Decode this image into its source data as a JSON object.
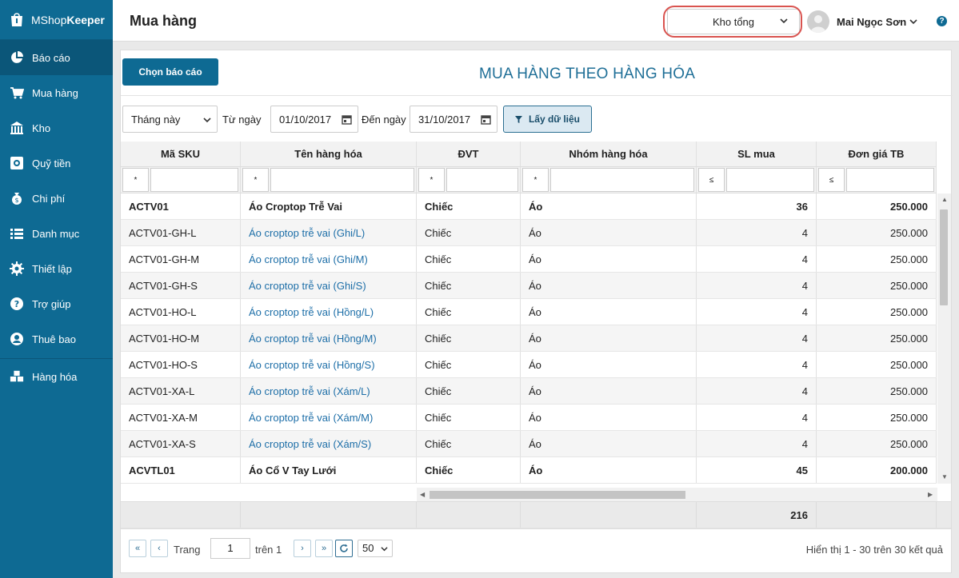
{
  "brand": {
    "name_light": "MShop",
    "name_bold": "Keeper"
  },
  "sidebar": {
    "items": [
      {
        "label": "Báo cáo",
        "icon": "pie-chart-icon"
      },
      {
        "label": "Mua hàng",
        "icon": "cart-icon"
      },
      {
        "label": "Kho",
        "icon": "warehouse-icon"
      },
      {
        "label": "Quỹ tiền",
        "icon": "safe-icon"
      },
      {
        "label": "Chi phí",
        "icon": "expense-icon"
      },
      {
        "label": "Danh mục",
        "icon": "list-icon"
      },
      {
        "label": "Thiết lập",
        "icon": "gear-icon"
      },
      {
        "label": "Trợ giúp",
        "icon": "help-icon"
      },
      {
        "label": "Thuê bao",
        "icon": "user-icon"
      },
      {
        "label": "Hàng hóa",
        "icon": "boxes-icon"
      }
    ]
  },
  "header": {
    "title": "Mua hàng",
    "store": "Kho tổng",
    "user": "Mai Ngọc Sơn",
    "help": "?"
  },
  "toolbar": {
    "choose_report": "Chọn báo cáo",
    "report_title": "MUA HÀNG THEO HÀNG HÓA",
    "period": "Tháng này",
    "from_label": "Từ ngày",
    "from_date": "01/10/2017",
    "to_label": "Đến ngày",
    "to_date": "31/10/2017",
    "fetch": "Lấy dữ liệu"
  },
  "table": {
    "columns": [
      "Mã SKU",
      "Tên hàng hóa",
      "ĐVT",
      "Nhóm hàng hóa",
      "SL mua",
      "Đơn giá TB"
    ],
    "filter_ops": [
      "*",
      "*",
      "*",
      "*",
      "≤",
      "≤"
    ],
    "rows": [
      {
        "sku": "ACTV01",
        "name": "Áo Croptop Trễ Vai",
        "unit": "Chiếc",
        "group": "Áo",
        "qty": "36",
        "price": "250.000"
      },
      {
        "sku": "ACTV01-GH-L",
        "name": "Áo croptop trễ vai (Ghi/L)",
        "unit": "Chiếc",
        "group": "Áo",
        "qty": "4",
        "price": "250.000"
      },
      {
        "sku": "ACTV01-GH-M",
        "name": "Áo croptop trễ vai (Ghi/M)",
        "unit": "Chiếc",
        "group": "Áo",
        "qty": "4",
        "price": "250.000"
      },
      {
        "sku": "ACTV01-GH-S",
        "name": "Áo croptop trễ vai (Ghi/S)",
        "unit": "Chiếc",
        "group": "Áo",
        "qty": "4",
        "price": "250.000"
      },
      {
        "sku": "ACTV01-HO-L",
        "name": "Áo croptop trễ vai (Hồng/L)",
        "unit": "Chiếc",
        "group": "Áo",
        "qty": "4",
        "price": "250.000"
      },
      {
        "sku": "ACTV01-HO-M",
        "name": "Áo croptop trễ vai (Hồng/M)",
        "unit": "Chiếc",
        "group": "Áo",
        "qty": "4",
        "price": "250.000"
      },
      {
        "sku": "ACTV01-HO-S",
        "name": "Áo croptop trễ vai (Hồng/S)",
        "unit": "Chiếc",
        "group": "Áo",
        "qty": "4",
        "price": "250.000"
      },
      {
        "sku": "ACTV01-XA-L",
        "name": "Áo croptop trễ vai (Xám/L)",
        "unit": "Chiếc",
        "group": "Áo",
        "qty": "4",
        "price": "250.000"
      },
      {
        "sku": "ACTV01-XA-M",
        "name": "Áo croptop trễ vai (Xám/M)",
        "unit": "Chiếc",
        "group": "Áo",
        "qty": "4",
        "price": "250.000"
      },
      {
        "sku": "ACTV01-XA-S",
        "name": "Áo croptop trễ vai (Xám/S)",
        "unit": "Chiếc",
        "group": "Áo",
        "qty": "4",
        "price": "250.000"
      },
      {
        "sku": "ACVTL01",
        "name": "Áo Cổ V Tay Lưới",
        "unit": "Chiếc",
        "group": "Áo",
        "qty": "45",
        "price": "200.000"
      }
    ],
    "total_qty": "216"
  },
  "pager": {
    "page_label": "Trang",
    "page": "1",
    "of_label": "trên 1",
    "page_size": "50",
    "info": "Hiển thị 1 - 30 trên 30 kết quả"
  },
  "colors": {
    "sidebar": "#0e6a93",
    "accent": "#1f6f97",
    "link": "#1e6fa8",
    "highlight": "#d9534f"
  }
}
